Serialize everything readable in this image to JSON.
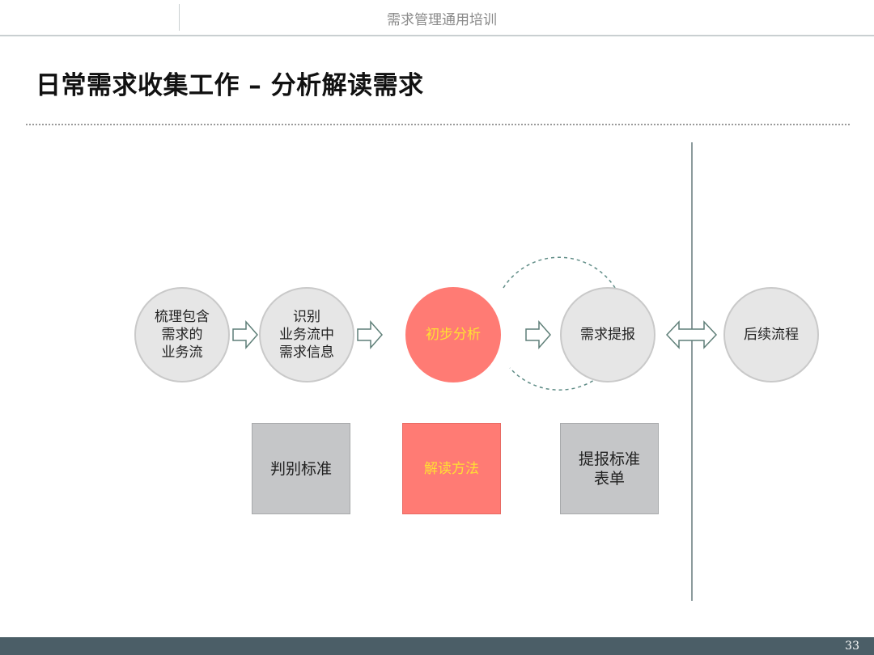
{
  "header": {
    "title": "需求管理通用培训"
  },
  "slide": {
    "title": "日常需求收集工作 – 分析解读需求"
  },
  "flow": {
    "steps": [
      {
        "label": "梳理包含\n需求的\n业务流"
      },
      {
        "label": "识别\n业务流中\n需求信息"
      },
      {
        "label": "初步分析"
      },
      {
        "label": "需求提报"
      },
      {
        "label": "后续流程"
      }
    ],
    "boxes": [
      {
        "label": "判别标准"
      },
      {
        "label": "解读方法"
      },
      {
        "label": "提报标准\n表单"
      }
    ],
    "colors": {
      "active": "#ff7b74",
      "active_text": "#ffe033",
      "neutral": "#e6e6e6",
      "box": "#c5c6c8",
      "arrow": "#5f7f78"
    }
  },
  "footer": {
    "page_number": "33"
  }
}
